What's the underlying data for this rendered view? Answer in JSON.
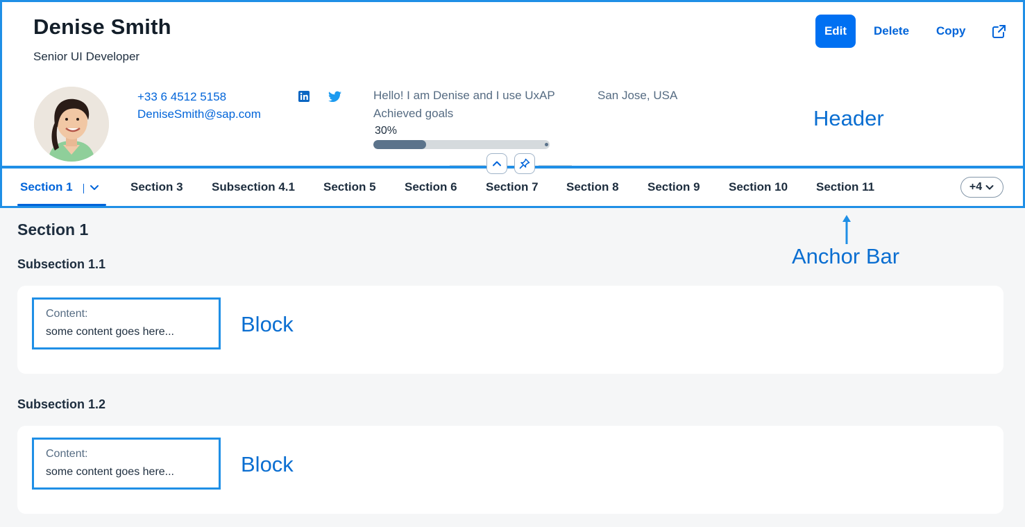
{
  "header": {
    "title": "Denise Smith",
    "subtitle": "Senior UI Developer",
    "actions": {
      "edit": "Edit",
      "delete": "Delete",
      "copy": "Copy",
      "share_icon": "share-icon"
    },
    "contact": {
      "phone": "+33 6 4512 5158",
      "email": "DeniseSmith@sap.com"
    },
    "social_icons": [
      "linkedin-icon",
      "twitter-icon"
    ],
    "intro": "Hello! I am Denise and I use UxAP",
    "kpi_label": "Achieved goals",
    "kpi_value": "30%",
    "kpi_fraction": 0.3,
    "location": "San Jose, USA",
    "annotation": "Header"
  },
  "anchor_bar": {
    "tabs": [
      {
        "label": "Section 1",
        "active": true
      },
      {
        "label": "Section 3"
      },
      {
        "label": "Subsection 4.1"
      },
      {
        "label": "Section 5"
      },
      {
        "label": "Section 6"
      },
      {
        "label": "Section 7"
      },
      {
        "label": "Section 8"
      },
      {
        "label": "Section 9"
      },
      {
        "label": "Section 10"
      },
      {
        "label": "Section 11"
      }
    ],
    "overflow": "+4",
    "annotation": "Anchor Bar"
  },
  "content": {
    "section_title": "Section 1",
    "subsections": [
      {
        "title": "Subsection 1.1",
        "block_label": "Content:",
        "block_value": "some content goes here...",
        "annotation": "Block"
      },
      {
        "title": "Subsection 1.2",
        "block_label": "Content:",
        "block_value": "some content goes here...",
        "annotation": "Block"
      }
    ]
  },
  "colors": {
    "accent": "#0070f2",
    "annotation": "#1f8fe6",
    "link": "#0064d9"
  }
}
